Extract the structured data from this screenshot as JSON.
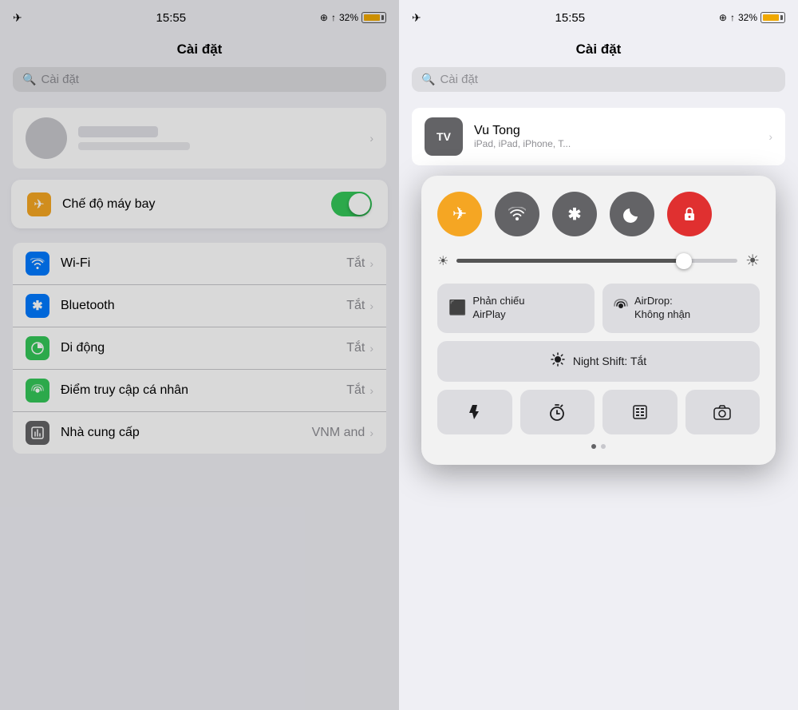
{
  "left": {
    "statusBar": {
      "time": "15:55",
      "locationIcon": "⊕",
      "arrowIcon": "↑",
      "batteryPercent": "32%",
      "planeIcon": "✈"
    },
    "title": "Cài đặt",
    "search": {
      "placeholder": "Cài đặt"
    },
    "profileName": "",
    "profileSub": "",
    "items": [
      {
        "label": "Chế độ máy bay",
        "iconColor": "orange",
        "iconSymbol": "✈",
        "toggle": true,
        "toggleOn": true
      },
      {
        "label": "Wi-Fi",
        "iconColor": "blue",
        "iconSymbol": "📶",
        "value": "Tắt",
        "hasChevron": true
      },
      {
        "label": "Bluetooth",
        "iconColor": "blue",
        "iconSymbol": "✱",
        "value": "Tắt",
        "hasChevron": true
      },
      {
        "label": "Di động",
        "iconColor": "green",
        "iconSymbol": "📡",
        "value": "Tắt",
        "hasChevron": true
      },
      {
        "label": "Điểm truy cập cá nhân",
        "iconColor": "green",
        "iconSymbol": "🔗",
        "value": "Tắt",
        "hasChevron": true
      },
      {
        "label": "Nhà cung cấp",
        "iconColor": "gray",
        "iconSymbol": "⚙",
        "value": "VNM and",
        "hasChevron": true
      }
    ]
  },
  "right": {
    "statusBar": {
      "time": "15:55",
      "planeIcon": "✈"
    },
    "title": "Cài đặt",
    "search": {
      "placeholder": "Cài đặt"
    },
    "profile": {
      "initials": "TV",
      "name": "Vu Tong",
      "sub": "iPad, iPad, iPhone, T..."
    },
    "controlCenter": {
      "buttons": [
        {
          "icon": "✈",
          "color": "orange",
          "label": "airplane"
        },
        {
          "icon": "wifi",
          "color": "gray",
          "label": "wifi"
        },
        {
          "icon": "bluetooth",
          "color": "gray",
          "label": "bluetooth"
        },
        {
          "icon": "moon",
          "color": "gray",
          "label": "do-not-disturb"
        },
        {
          "icon": "lock",
          "color": "red",
          "label": "screen-lock"
        }
      ],
      "brightness": 80,
      "tiles": [
        {
          "icon": "⬛",
          "line1": "Phản chiếu",
          "line2": "AirPlay"
        },
        {
          "icon": "((·))",
          "line1": "AirDrop:",
          "line2": "Không nhận"
        }
      ],
      "nightShift": "Night Shift: Tắt",
      "bottomIcons": [
        "🔦",
        "⏱",
        "⊞",
        "📷"
      ],
      "dots": [
        true,
        false
      ]
    }
  }
}
